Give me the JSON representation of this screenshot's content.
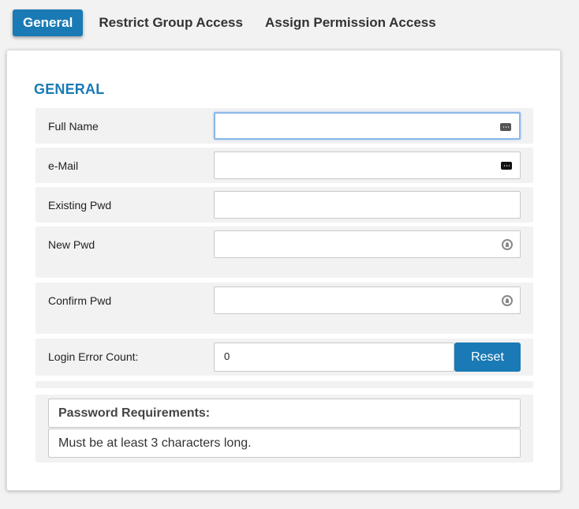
{
  "tabs": [
    {
      "label": "General",
      "active": true
    },
    {
      "label": "Restrict Group Access",
      "active": false
    },
    {
      "label": "Assign Permission Access",
      "active": false
    }
  ],
  "section_title": "GENERAL",
  "form": {
    "full_name": {
      "label": "Full Name",
      "value": ""
    },
    "email": {
      "label": "e-Mail",
      "value": ""
    },
    "existing_pwd": {
      "label": "Existing Pwd",
      "value": ""
    },
    "new_pwd": {
      "label": "New Pwd",
      "value": ""
    },
    "confirm_pwd": {
      "label": "Confirm Pwd",
      "value": ""
    },
    "login_error_count": {
      "label": "Login Error Count:",
      "value": "0"
    },
    "reset_label": "Reset"
  },
  "password_requirements": {
    "title": "Password Requirements:",
    "items": [
      "Must be at least 3 characters long."
    ]
  },
  "colors": {
    "accent": "#1a7ab5",
    "row_background": "#f2f2f2"
  }
}
